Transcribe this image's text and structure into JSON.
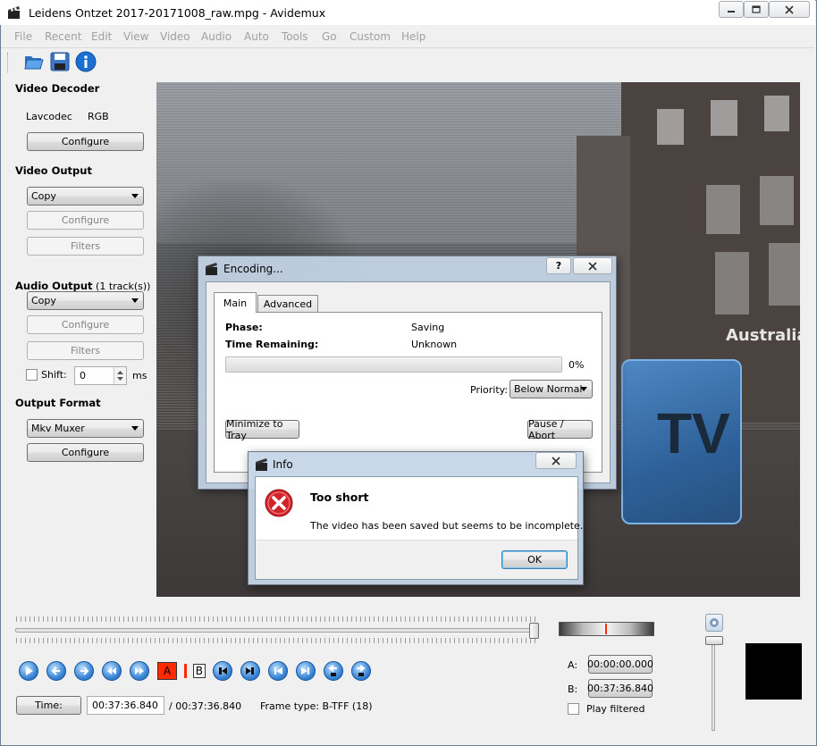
{
  "window": {
    "title": "Leidens Ontzet 2017-20171008_raw.mpg - Avidemux",
    "controls": [
      "minimize-icon",
      "maximize-icon",
      "close-icon"
    ]
  },
  "menu": [
    "File",
    "Recent",
    "Edit",
    "View",
    "Video",
    "Audio",
    "Auto",
    "Tools",
    "Go",
    "Custom",
    "Help"
  ],
  "toolbar": {
    "icons": [
      "open-folder-icon",
      "save-icon",
      "info-icon"
    ]
  },
  "video_decoder": {
    "heading": "Video Decoder",
    "codec": "Lavcodec",
    "format": "RGB",
    "configure": "Configure"
  },
  "video_output": {
    "heading": "Video Output",
    "codec": "Copy",
    "configure": "Configure",
    "filters": "Filters"
  },
  "audio_output": {
    "heading": "Audio Output",
    "tracks": "(1 track(s))",
    "codec": "Copy",
    "configure": "Configure",
    "filters": "Filters",
    "shift_label": "Shift:",
    "shift_value": "0",
    "shift_unit": "ms"
  },
  "output_format": {
    "heading": "Output Format",
    "muxer": "Mkv Muxer",
    "configure": "Configure"
  },
  "video_overlay_text": {
    "sign": "Australia",
    "tv": "TV"
  },
  "encoding_dialog": {
    "title": "Encoding...",
    "help": "?",
    "tabs": [
      "Main",
      "Advanced"
    ],
    "phase_label": "Phase:",
    "phase_value": "Saving",
    "time_label": "Time Remaining:",
    "time_value": "Unknown",
    "progress_text": "0%",
    "progress": 0,
    "priority_label": "Priority:",
    "priority_value": "Below Normal",
    "minimize_button": "Minimize to Tray",
    "pause_button": "Pause / Abort"
  },
  "info_dialog": {
    "title": "Info",
    "heading": "Too short",
    "message": "The video has been saved but seems to be incomplete.",
    "ok": "OK",
    "icon": "error-icon"
  },
  "navigation": {
    "buttons": [
      "play-icon",
      "previous-frame-icon",
      "next-frame-icon",
      "rewind-icon",
      "fast-forward-icon",
      "set-marker-a-icon",
      "set-marker-b-icon",
      "previous-black-frame-icon",
      "next-black-frame-icon",
      "first-frame-icon",
      "last-frame-icon",
      "previous-keyframe-icon",
      "next-keyframe-icon"
    ],
    "marker_a_label": "A",
    "marker_b_label": "B"
  },
  "status": {
    "time_button": "Time:",
    "current_time": "00:37:36.840",
    "total_time": "/ 00:37:36.840",
    "frame_type": "Frame type:  B-TFF (18)"
  },
  "selection": {
    "a_label": "A:",
    "a_value": "00:00:00.000",
    "b_label": "B:",
    "b_value": "00:37:36.840",
    "play_filtered": "Play filtered"
  },
  "colors": {
    "accent": "#3b86d6",
    "error": "#d2232a",
    "marker": "#ff2a00",
    "video_bg": "#5a5654"
  }
}
